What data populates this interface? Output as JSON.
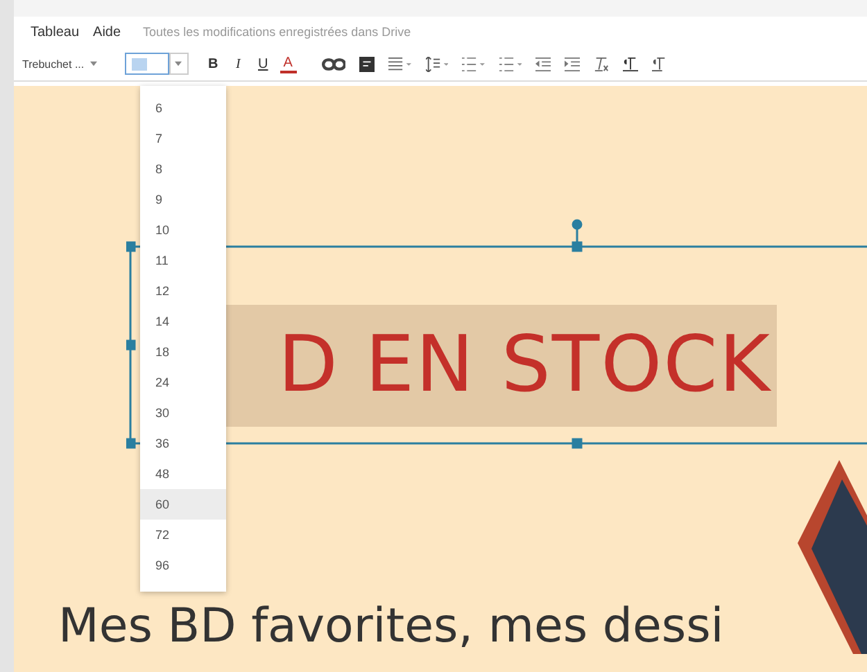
{
  "menu": {
    "items": [
      "Tableau",
      "Aide"
    ],
    "status": "Toutes les modifications enregistrées dans Drive"
  },
  "toolbar": {
    "font": "Trebuchet ...",
    "format_buttons": [
      "B",
      "I",
      "U",
      "A"
    ]
  },
  "font_size_menu": {
    "options": [
      {
        "label": "6",
        "selected": false
      },
      {
        "label": "7",
        "selected": false
      },
      {
        "label": "8",
        "selected": false
      },
      {
        "label": "9",
        "selected": false
      },
      {
        "label": "10",
        "selected": false
      },
      {
        "label": "11",
        "selected": false
      },
      {
        "label": "12",
        "selected": false
      },
      {
        "label": "14",
        "selected": false
      },
      {
        "label": "18",
        "selected": false
      },
      {
        "label": "24",
        "selected": false
      },
      {
        "label": "30",
        "selected": false
      },
      {
        "label": "36",
        "selected": false
      },
      {
        "label": "48",
        "selected": false
      },
      {
        "label": "60",
        "selected": true
      },
      {
        "label": "72",
        "selected": false
      },
      {
        "label": "96",
        "selected": false
      }
    ]
  },
  "slide": {
    "title": "D EN STOCK",
    "subtitle": "Mes BD favorites, mes dessi"
  }
}
